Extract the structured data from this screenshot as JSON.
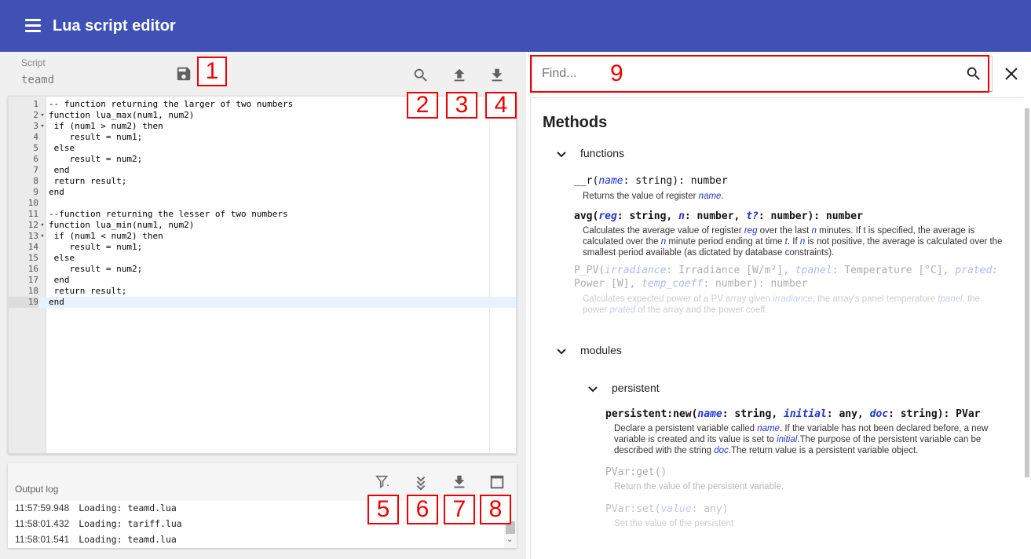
{
  "appbar": {
    "title": "Lua script editor",
    "menu_icon": "menu-icon"
  },
  "script": {
    "label": "Script",
    "name": "teamd"
  },
  "toolbar": {
    "save_icon": "save-icon",
    "search_icon": "search-icon",
    "upload_icon": "upload-icon",
    "download_icon": "download-icon"
  },
  "badges": [
    "1",
    "2",
    "3",
    "4",
    "5",
    "6",
    "7",
    "8",
    "9"
  ],
  "editor": {
    "lines": [
      {
        "n": "1",
        "fold": "",
        "text": "-- function returning the larger of two numbers",
        "kind": "comment"
      },
      {
        "n": "2",
        "fold": "▾",
        "text": "function lua_max(num1, num2)",
        "kind": "code"
      },
      {
        "n": "3",
        "fold": "▾",
        "text": " if (num1 > num2) then",
        "kind": "code"
      },
      {
        "n": "4",
        "fold": "",
        "text": "    result = num1;",
        "kind": "code"
      },
      {
        "n": "5",
        "fold": "",
        "text": " else",
        "kind": "code"
      },
      {
        "n": "6",
        "fold": "",
        "text": "    result = num2;",
        "kind": "code"
      },
      {
        "n": "7",
        "fold": "",
        "text": " end",
        "kind": "code"
      },
      {
        "n": "8",
        "fold": "",
        "text": " return result;",
        "kind": "code"
      },
      {
        "n": "9",
        "fold": "",
        "text": "end",
        "kind": "code"
      },
      {
        "n": "10",
        "fold": "",
        "text": "",
        "kind": "code"
      },
      {
        "n": "11",
        "fold": "",
        "text": "--function returning the lesser of two numbers",
        "kind": "comment2"
      },
      {
        "n": "12",
        "fold": "▾",
        "text": "function lua_min(num1, num2)",
        "kind": "code"
      },
      {
        "n": "13",
        "fold": "▾",
        "text": " if (num1 < num2) then",
        "kind": "code"
      },
      {
        "n": "14",
        "fold": "",
        "text": "    result = num1;",
        "kind": "code"
      },
      {
        "n": "15",
        "fold": "",
        "text": " else",
        "kind": "code"
      },
      {
        "n": "16",
        "fold": "",
        "text": "    result = num2;",
        "kind": "code"
      },
      {
        "n": "17",
        "fold": "",
        "text": " end",
        "kind": "code"
      },
      {
        "n": "18",
        "fold": "",
        "text": " return result;",
        "kind": "code"
      },
      {
        "n": "19",
        "fold": "",
        "text": "end",
        "kind": "code"
      }
    ],
    "active_line": "19"
  },
  "log": {
    "title": "Output log",
    "icons": [
      "filter-icon",
      "scroll-down-icon",
      "download-icon",
      "maximize-icon"
    ],
    "rows": [
      {
        "time": "11:57:59.948",
        "msg": "Loading: teamd.lua"
      },
      {
        "time": "11:58:01.432",
        "msg": "Loading: tariff.lua"
      },
      {
        "time": "11:58:01.541",
        "msg": "Loading: teamd.lua"
      }
    ]
  },
  "find": {
    "placeholder": "Find..."
  },
  "docs": {
    "heading": "Methods",
    "functions_label": "functions",
    "modules_label": "modules",
    "persistent_label": "persistent",
    "r": {
      "name": "__r(",
      "p1": "name",
      "rest": ": string): number",
      "desc_a": "Returns the value of register ",
      "desc_em": "name",
      "desc_b": "."
    },
    "avg": {
      "name": "avg(",
      "p1": "reg",
      "s1": ": string, ",
      "p2": "n",
      "s2": ": number, ",
      "p3": "t?",
      "s3": ": number): number",
      "d1": "Calculates the average value of register ",
      "d1e": "reg",
      "d2": " over the last ",
      "d2e": "n",
      "d3": " minutes. If t is specified, the average is",
      "d4": "calculated over the ",
      "d4e": "n",
      "d5": " minute period ending at time ",
      "d5e": "t",
      "d6": ". If ",
      "d6e": "n",
      "d7": " is not positive, the average is calculated over the",
      "d8": "smallest period available (as dictated by database constraints)."
    },
    "ppv": {
      "name": "P_PV(",
      "p1": "irradiance",
      "s1": ": Irradiance [W/m²], ",
      "p2": "tpanel",
      "s2": ": Temperature [°C], ",
      "p3": "prated:",
      "l2a": "Power [W], ",
      "p4": "temp_coeff",
      "l2b": ": number): number",
      "d1": "Calculates expected power of a PV array given ",
      "d1e": "irradiance",
      "d2": ", the array's panel temperature ",
      "d2e": "tpanel",
      "d3": ", the",
      "d4": "power ",
      "d4e": "prated",
      "d5": " of the array and the power coeff."
    },
    "pnew": {
      "name": "persistent:new(",
      "p1": "name",
      "s1": ": string, ",
      "p2": "initial",
      "s2": ": any, ",
      "p3": "doc",
      "s3": ": string): PVar",
      "d1": "Declare a persistent variable called ",
      "d1e": "name",
      "d2": ". If the variable has not been declared before, a new",
      "d3": "variable is created and its value is set to ",
      "d3e": "initial",
      "d4": ".The purpose of the persistent variable can be",
      "d5": "described with the string ",
      "d5e": "doc",
      "d6": ".The return value is a persistent variable object."
    },
    "pget": {
      "name": "PVar:get()",
      "desc": "Return the value of the persistent variable."
    },
    "pset": {
      "name": "PVar:set(",
      "p1": "value",
      "rest": ": any)",
      "desc": "Set the value of the persistent"
    }
  }
}
